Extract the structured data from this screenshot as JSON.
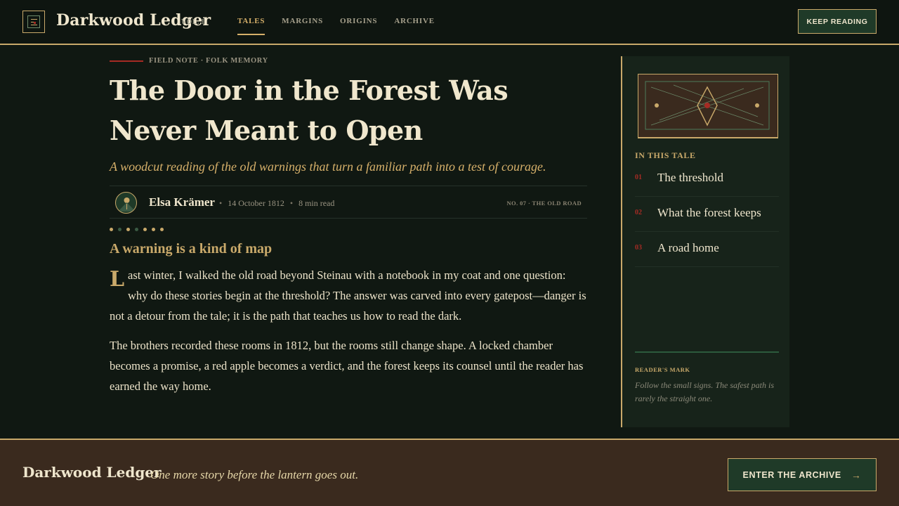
{
  "header": {
    "brand": "Darkwood Ledger",
    "volume": "VOL. I",
    "nav": [
      "TALES",
      "MARGINS",
      "ORIGINS",
      "ARCHIVE"
    ],
    "active_nav": "TALES",
    "cta_label": "KEEP READING"
  },
  "article": {
    "kicker": "FIELD NOTE · FOLK MEMORY",
    "title": "The Door in the Forest Was Never Meant to Open",
    "dek": "A woodcut reading of the old warnings that turn a familiar path into a test of courage.",
    "author": "Elsa Krämer",
    "date": "14 October 1812",
    "read_time": "8 min read",
    "issue": "NO. 07 · THE OLD ROAD",
    "section_heading": "A warning is a kind of map",
    "drop_cap": "L",
    "paragraph_1_rest": "ast winter, I walked the old road beyond Steinau with a notebook in my coat and one question: why do these stories begin at the threshold? The answer was carved into every gatepost—danger is not a detour from the tale; it is the path that teaches us how to read the dark.",
    "paragraph_2": "The brothers recorded these rooms in 1812, but the rooms still change shape. A locked chamber becomes a promise, a red apple becomes a verdict, and the forest keeps its counsel until the reader has earned the way home."
  },
  "sidebar": {
    "toc_label": "IN THIS TALE",
    "toc": [
      {
        "num": "01",
        "label": "The threshold"
      },
      {
        "num": "02",
        "label": "What the forest keeps"
      },
      {
        "num": "03",
        "label": "A road home"
      }
    ],
    "mark_label": "READER'S MARK",
    "mark_text": "Follow the small signs. The safest path is rarely the straight one."
  },
  "footer": {
    "brand": "Darkwood Ledger",
    "tagline": "One more story before the lantern goes out.",
    "cta_label": "ENTER THE ARCHIVE",
    "cta_icon": "arrow-right-icon"
  },
  "colors": {
    "background": "#101812",
    "gold": "#c9a96a",
    "forest_green": "#1f3a28",
    "crimson": "#a62b24",
    "bark": "#3a2a1e",
    "parchment": "#efe6cd"
  }
}
